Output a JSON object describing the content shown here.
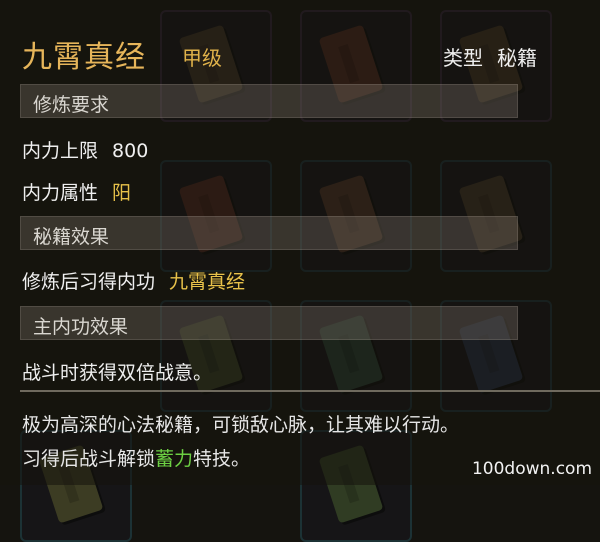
{
  "item": {
    "name": "九霄真经",
    "grade": "甲级",
    "type_label": "类型",
    "type_value": "秘籍"
  },
  "sections": {
    "requirements": "修炼要求",
    "effects": "秘籍效果",
    "main_effect": "主内功效果"
  },
  "requirements": {
    "max_neili_label": "内力上限",
    "max_neili_value": "800",
    "attribute_label": "内力属性",
    "attribute_value": "阳"
  },
  "effects": {
    "learn_label": "修炼后习得内功",
    "learn_value": "九霄真经"
  },
  "main_effect_text": "战斗时获得双倍战意。",
  "description": {
    "line1": "极为高深的心法秘籍，可锁敌心脉，让其难以行动。",
    "line2_pre": "习得后战斗解锁",
    "line2_highlight": "蓄力",
    "line2_post": "特技。"
  },
  "watermark": "100down.com",
  "colors": {
    "title": "#e6b55a",
    "highlight_gold": "#e8c24a",
    "highlight_green": "#6cd043"
  }
}
